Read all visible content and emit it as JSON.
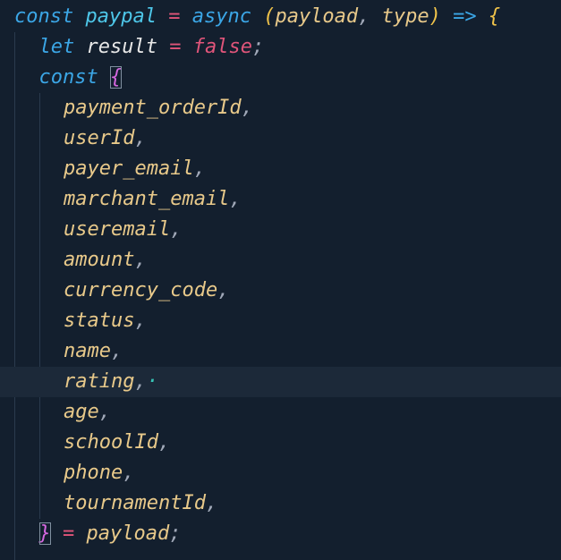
{
  "editor": {
    "lines": [
      {
        "id": "l1",
        "indent": 0,
        "tokens": [
          {
            "t": "const ",
            "c": "#3ba6e6"
          },
          {
            "t": "paypal",
            "c": "#4ec7e9"
          },
          {
            "t": " = ",
            "c": "#e0557a"
          },
          {
            "t": "async ",
            "c": "#3ba6e6"
          },
          {
            "t": "(",
            "c": "#f0c34a"
          },
          {
            "t": "payload",
            "c": "#e8c98a"
          },
          {
            "t": ", ",
            "c": "#a0a8b8"
          },
          {
            "t": "type",
            "c": "#e8c98a"
          },
          {
            "t": ") ",
            "c": "#f0c34a"
          },
          {
            "t": "=>",
            "c": "#3ba6e6"
          },
          {
            "t": " {",
            "c": "#f0c34a"
          }
        ]
      },
      {
        "id": "l2",
        "indent": 1,
        "tokens": [
          {
            "t": "let ",
            "c": "#3ba6e6"
          },
          {
            "t": "result",
            "c": "#e8e8e8"
          },
          {
            "t": " = ",
            "c": "#e0557a"
          },
          {
            "t": "false",
            "c": "#e0557a"
          },
          {
            "t": ";",
            "c": "#a0a8b8"
          }
        ]
      },
      {
        "id": "l3",
        "indent": 1,
        "tokens": [
          {
            "t": "const ",
            "c": "#3ba6e6"
          },
          {
            "t": "{",
            "c": "#d568e0",
            "box": true
          }
        ]
      },
      {
        "id": "l4",
        "indent": 2,
        "tokens": [
          {
            "t": "payment_orderId",
            "c": "#e8c98a"
          },
          {
            "t": ",",
            "c": "#a0a8b8"
          }
        ]
      },
      {
        "id": "l5",
        "indent": 2,
        "tokens": [
          {
            "t": "userId",
            "c": "#e8c98a"
          },
          {
            "t": ",",
            "c": "#a0a8b8"
          }
        ]
      },
      {
        "id": "l6",
        "indent": 2,
        "tokens": [
          {
            "t": "payer_email",
            "c": "#e8c98a"
          },
          {
            "t": ",",
            "c": "#a0a8b8"
          }
        ]
      },
      {
        "id": "l7",
        "indent": 2,
        "tokens": [
          {
            "t": "marchant_email",
            "c": "#e8c98a"
          },
          {
            "t": ",",
            "c": "#a0a8b8"
          }
        ]
      },
      {
        "id": "l8",
        "indent": 2,
        "tokens": [
          {
            "t": "useremail",
            "c": "#e8c98a"
          },
          {
            "t": ",",
            "c": "#a0a8b8"
          }
        ]
      },
      {
        "id": "l9",
        "indent": 2,
        "tokens": [
          {
            "t": "amount",
            "c": "#e8c98a"
          },
          {
            "t": ",",
            "c": "#a0a8b8"
          }
        ]
      },
      {
        "id": "l10",
        "indent": 2,
        "tokens": [
          {
            "t": "currency_code",
            "c": "#e8c98a"
          },
          {
            "t": ",",
            "c": "#a0a8b8"
          }
        ]
      },
      {
        "id": "l11",
        "indent": 2,
        "tokens": [
          {
            "t": "status",
            "c": "#e8c98a"
          },
          {
            "t": ",",
            "c": "#a0a8b8"
          }
        ]
      },
      {
        "id": "l12",
        "indent": 2,
        "tokens": [
          {
            "t": "name",
            "c": "#e8c98a"
          },
          {
            "t": ",",
            "c": "#a0a8b8"
          }
        ]
      },
      {
        "id": "l13",
        "indent": 2,
        "active": true,
        "tokens": [
          {
            "t": "rating",
            "c": "#e8c98a"
          },
          {
            "t": ",",
            "c": "#a0a8b8"
          },
          {
            "t": "·",
            "c": "#37c3b5"
          }
        ]
      },
      {
        "id": "l14",
        "indent": 2,
        "tokens": [
          {
            "t": "age",
            "c": "#e8c98a"
          },
          {
            "t": ",",
            "c": "#a0a8b8"
          }
        ]
      },
      {
        "id": "l15",
        "indent": 2,
        "tokens": [
          {
            "t": "schoolId",
            "c": "#e8c98a"
          },
          {
            "t": ",",
            "c": "#a0a8b8"
          }
        ]
      },
      {
        "id": "l16",
        "indent": 2,
        "tokens": [
          {
            "t": "phone",
            "c": "#e8c98a"
          },
          {
            "t": ",",
            "c": "#a0a8b8"
          }
        ]
      },
      {
        "id": "l17",
        "indent": 2,
        "tokens": [
          {
            "t": "tournamentId",
            "c": "#e8c98a"
          },
          {
            "t": ",",
            "c": "#a0a8b8"
          }
        ]
      },
      {
        "id": "l18",
        "indent": 1,
        "tokens": [
          {
            "t": "}",
            "c": "#d568e0",
            "box": true
          },
          {
            "t": " = ",
            "c": "#e0557a"
          },
          {
            "t": "payload",
            "c": "#e8c98a"
          },
          {
            "t": ";",
            "c": "#a0a8b8"
          }
        ]
      }
    ]
  }
}
